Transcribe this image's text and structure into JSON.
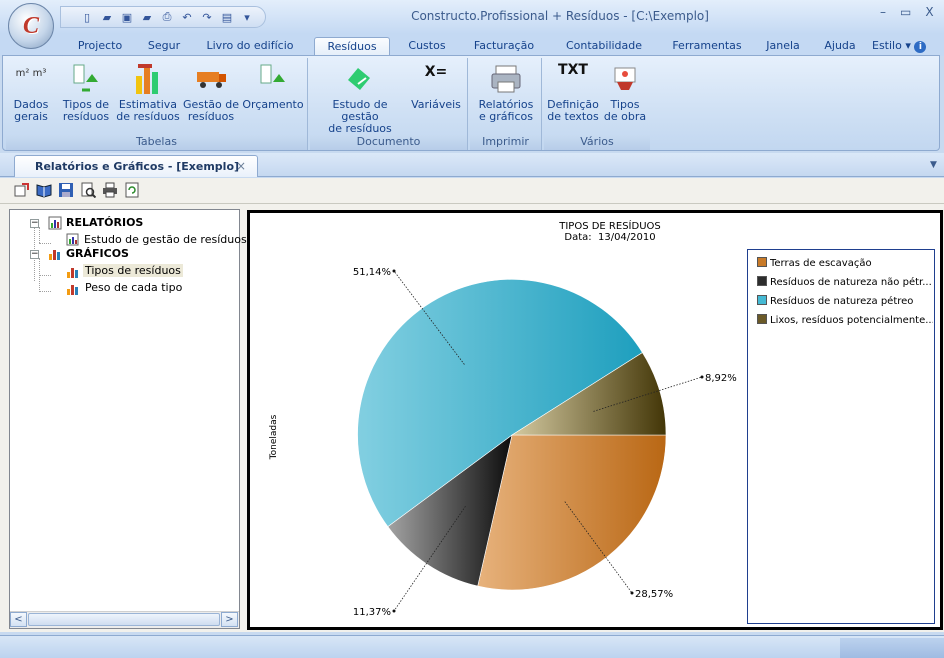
{
  "app": {
    "title": "Constructo.Profissional + Resíduos - [C:\\Exemplo]",
    "logo_letter": "C",
    "window_controls": [
      "–",
      "▭",
      "X"
    ]
  },
  "menu_tabs": [
    {
      "label": "Projecto",
      "active": false
    },
    {
      "label": "Segur",
      "active": false
    },
    {
      "label": "Livro do edifício",
      "active": false
    },
    {
      "label": "Resíduos",
      "active": true
    },
    {
      "label": "Custos",
      "active": false
    },
    {
      "label": "Facturação",
      "active": false
    },
    {
      "label": "Contabilidade",
      "active": false
    },
    {
      "label": "Ferramentas",
      "active": false
    },
    {
      "label": "Janela",
      "active": false
    },
    {
      "label": "Ajuda",
      "active": false
    }
  ],
  "style_menu": {
    "label": "Estilo",
    "arrow": "▾"
  },
  "ribbon": {
    "groups": [
      {
        "label": "Tabelas",
        "buttons": [
          {
            "line1": "Dados",
            "line2": "gerais",
            "icon_label": "m² m³"
          },
          {
            "line1": "Tipos de",
            "line2": "resíduos"
          },
          {
            "line1": "Estimativa",
            "line2": "de resíduos"
          },
          {
            "line1": "Gestão de",
            "line2": "resíduos"
          },
          {
            "line1": "Orçamento",
            "line2": ""
          }
        ]
      },
      {
        "label": "Documento",
        "buttons": [
          {
            "line1": "Estudo de gestão",
            "line2": "de resíduos"
          },
          {
            "line1": "Variáveis",
            "line2": "",
            "icon_label": "X="
          }
        ]
      },
      {
        "label": "Imprimir",
        "buttons": [
          {
            "line1": "Relatórios",
            "line2": "e gráficos"
          }
        ]
      },
      {
        "label": "Vários",
        "buttons": [
          {
            "line1": "Definição",
            "line2": "de textos",
            "icon_label": "TXT"
          },
          {
            "line1": "Tipos",
            "line2": "de obra"
          }
        ]
      }
    ]
  },
  "document_tab": {
    "label": "Relatórios e Gráficos - [Exemplo]",
    "close": "×"
  },
  "tree": {
    "reports_label": "RELATÓRIOS",
    "report_item": "Estudo de gestão de resíduos",
    "charts_label": "GRÁFICOS",
    "chart_items": [
      "Tipos de resíduos",
      "Peso de cada tipo"
    ],
    "expander_symbol": "−"
  },
  "scroll": {
    "left": "<",
    "right": ">"
  },
  "colors": {
    "terras": "#c87a28",
    "nao_petreo": "#2d2d2d",
    "petreo": "#45b9d3",
    "lixos": "#6b5a28"
  },
  "chart_data": {
    "type": "pie",
    "title": "TIPOS DE RESÍDUOS",
    "subtitle": "Data:  13/04/2010",
    "ylabel": "Toneladas",
    "legend_position": "right",
    "slices": [
      {
        "name": "Terras de escavação",
        "value": 28.57,
        "label": "28,57%",
        "color": "#c87a28"
      },
      {
        "name": "Resíduos de natureza não pétr...",
        "value": 11.37,
        "label": "11,37%",
        "color": "#2d2d2d"
      },
      {
        "name": "Resíduos de natureza pétreo",
        "value": 51.14,
        "label": "51,14%",
        "color": "#45b9d3"
      },
      {
        "name": "Lixos, resíduos potencialmente...",
        "value": 8.92,
        "label": "8,92%",
        "color": "#6b5a28"
      }
    ]
  }
}
